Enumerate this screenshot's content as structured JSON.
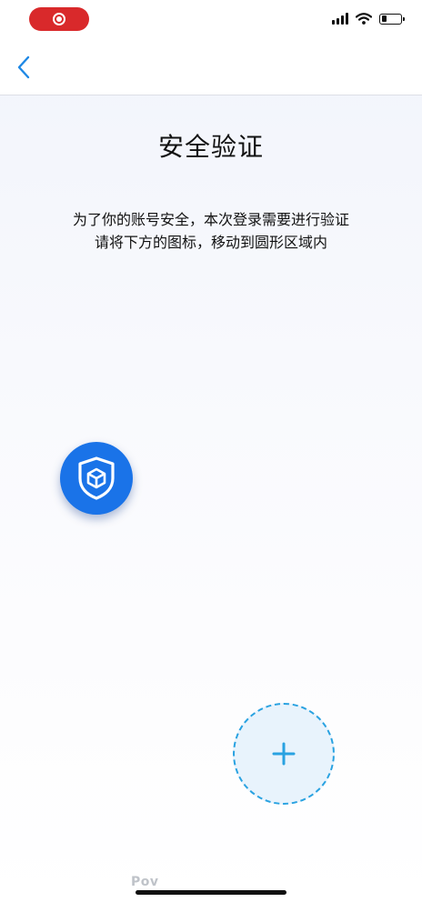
{
  "status_bar": {
    "recording_icon": "record-icon",
    "signal_icon": "cellular-signal-icon",
    "wifi_icon": "wifi-icon",
    "battery_icon": "battery-icon",
    "battery_level": 0.25
  },
  "nav": {
    "back_icon": "chevron-left-icon"
  },
  "page": {
    "title": "安全验证",
    "instruction_line1": "为了你的账号安全，本次登录需要进行验证",
    "instruction_line2": "请将下方的图标，移动到圆形区域内"
  },
  "captcha": {
    "drag_icon": "shield-cube-icon",
    "target_icon": "plus-icon"
  },
  "footer": {
    "text": "Pov"
  },
  "colors": {
    "accent_blue": "#1a73e8",
    "nav_blue": "#1e88e5",
    "target_border": "#29a2e1",
    "target_fill": "#e8f3fc",
    "record_red": "#d9292b"
  }
}
